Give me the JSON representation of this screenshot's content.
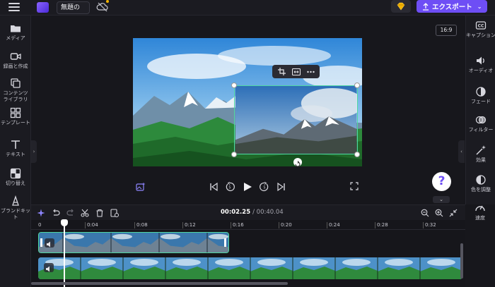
{
  "topbar": {
    "project_title": "無題の",
    "export_label": "エクスポート"
  },
  "sidebar_left": {
    "items": [
      {
        "label": "メディア",
        "icon": "folder-icon"
      },
      {
        "label": "録画と作成",
        "icon": "camera-icon"
      },
      {
        "label": "コンテンツ\nライブラリ",
        "icon": "content-library-icon"
      },
      {
        "label": "テンプレート",
        "icon": "templates-icon"
      },
      {
        "label": "テキスト",
        "icon": "text-icon"
      },
      {
        "label": "切り替え",
        "icon": "transitions-icon"
      },
      {
        "label": "ブランドキット",
        "icon": "brand-kit-icon"
      }
    ]
  },
  "sidebar_right": {
    "items": [
      {
        "label": "キャプション",
        "icon": "captions-icon"
      },
      {
        "label": "オーディオ",
        "icon": "audio-icon"
      },
      {
        "label": "フェード",
        "icon": "fade-icon"
      },
      {
        "label": "フィルター",
        "icon": "filter-icon"
      },
      {
        "label": "効果",
        "icon": "effects-icon"
      },
      {
        "label": "色を調整",
        "icon": "color-adjust-icon"
      },
      {
        "label": "速度",
        "icon": "speed-icon"
      }
    ]
  },
  "preview": {
    "aspect_ratio": "16:9",
    "help_label": "?"
  },
  "timeline": {
    "current_time": "00:02.25",
    "total_time": "/ 00:40.04",
    "ruler_ticks": [
      "0",
      "0:04",
      "0:08",
      "0:12",
      "0:16",
      "0:20",
      "0:24",
      "0:28",
      "0:32"
    ]
  },
  "colors": {
    "accent": "#6e4ef5",
    "selection": "#4fd7a3",
    "background": "#17171c"
  }
}
